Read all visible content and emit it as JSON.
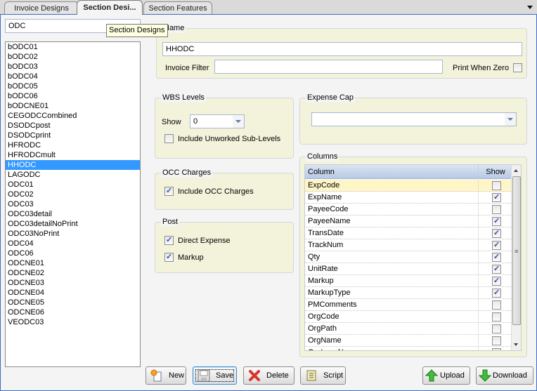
{
  "tabs": [
    {
      "label": "Invoice Designs"
    },
    {
      "label": "Section Desi...",
      "active": true
    },
    {
      "label": "Section Features"
    }
  ],
  "search": {
    "value": "ODC"
  },
  "tooltip": "Section Designs",
  "sections": {
    "selected": "HHODC",
    "items": [
      "bODC01",
      "bODC02",
      "bODC03",
      "bODC04",
      "bODC05",
      "bODC06",
      "bODCNE01",
      "CEGODCCombined",
      "DSODCpost",
      "DSODCprint",
      "HFRODC",
      "HFRODCmult",
      "HHODC",
      "LAGODC",
      "ODC01",
      "ODC02",
      "ODC03",
      "ODC03detail",
      "ODC03detailNoPrint",
      "ODC03NoPrint",
      "ODC04",
      "ODC06",
      "ODCNE01",
      "ODCNE02",
      "ODCNE03",
      "ODCNE04",
      "ODCNE05",
      "ODCNE06",
      "VEODC03"
    ]
  },
  "name_group": {
    "legend": "Name",
    "name_value": "HHODC",
    "invoice_filter_label": "Invoice Filter",
    "invoice_filter_value": "",
    "print_when_zero_label": "Print When Zero",
    "print_when_zero": false
  },
  "wbs": {
    "legend": "WBS Levels",
    "show_label": "Show",
    "show_value": "0",
    "include_unworked_label": "Include Unworked Sub-Levels",
    "include_unworked": false
  },
  "expense_cap": {
    "legend": "Expense Cap",
    "value": ""
  },
  "occ": {
    "legend": "OCC Charges",
    "include_label": "Include OCC Charges",
    "include": true
  },
  "post": {
    "legend": "Post",
    "direct_expense_label": "Direct Expense",
    "direct_expense": true,
    "markup_label": "Markup",
    "markup": true
  },
  "columns": {
    "legend": "Columns",
    "header_column": "Column",
    "header_show": "Show",
    "rows": [
      {
        "name": "ExpCode",
        "show": false
      },
      {
        "name": "ExpName",
        "show": true
      },
      {
        "name": "PayeeCode",
        "show": false
      },
      {
        "name": "PayeeName",
        "show": true
      },
      {
        "name": "TransDate",
        "show": true
      },
      {
        "name": "TrackNum",
        "show": true
      },
      {
        "name": "Qty",
        "show": true
      },
      {
        "name": "UnitRate",
        "show": true
      },
      {
        "name": "Markup",
        "show": true
      },
      {
        "name": "MarkupType",
        "show": true
      },
      {
        "name": "PMComments",
        "show": false
      },
      {
        "name": "OrgCode",
        "show": false
      },
      {
        "name": "OrgPath",
        "show": false
      },
      {
        "name": "OrgName",
        "show": false
      },
      {
        "name": "OrgLongName",
        "show": false
      }
    ]
  },
  "buttons": {
    "new": "New",
    "save": "Save",
    "delete": "Delete",
    "script": "Script",
    "upload": "Upload",
    "download": "Download"
  }
}
